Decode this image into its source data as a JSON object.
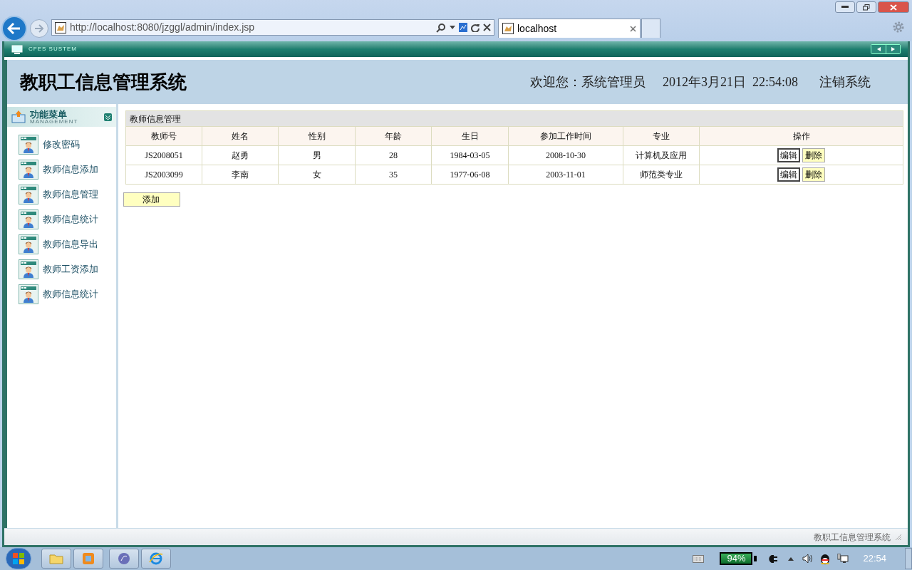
{
  "browser": {
    "url": "http://localhost:8080/jzggl/admin/index.jsp",
    "tab_title": "localhost"
  },
  "app": {
    "brand": "CFES SUSTEM",
    "title": "教职工信息管理系统",
    "welcome": "欢迎您：系统管理员",
    "datetime": "2012年3月21日  22:54:08",
    "logout": "注销系统"
  },
  "sidebar": {
    "title": "功能菜单",
    "subtitle": "MANAGEMENT",
    "items": [
      "修改密码",
      "教师信息添加",
      "教师信息管理",
      "教师信息统计",
      "教师信息导出",
      "教师工资添加",
      "教师信息统计"
    ]
  },
  "panel": {
    "title": "教师信息管理",
    "columns": [
      "教师号",
      "姓名",
      "性别",
      "年龄",
      "生日",
      "参加工作时间",
      "专业",
      "操作"
    ],
    "rows": [
      {
        "cells": [
          "JS2008051",
          "赵勇",
          "男",
          "28",
          "1984-03-05",
          "2008-10-30",
          "计算机及应用"
        ],
        "actions": [
          "编辑",
          "删除"
        ]
      },
      {
        "cells": [
          "JS2003099",
          "李南",
          "女",
          "35",
          "1977-06-08",
          "2003-11-01",
          "师范类专业"
        ],
        "actions": [
          "编辑",
          "删除"
        ]
      }
    ],
    "add_button": "添加"
  },
  "footer": "教职工信息管理系统",
  "taskbar": {
    "battery": "94%",
    "clock": "22:54"
  }
}
